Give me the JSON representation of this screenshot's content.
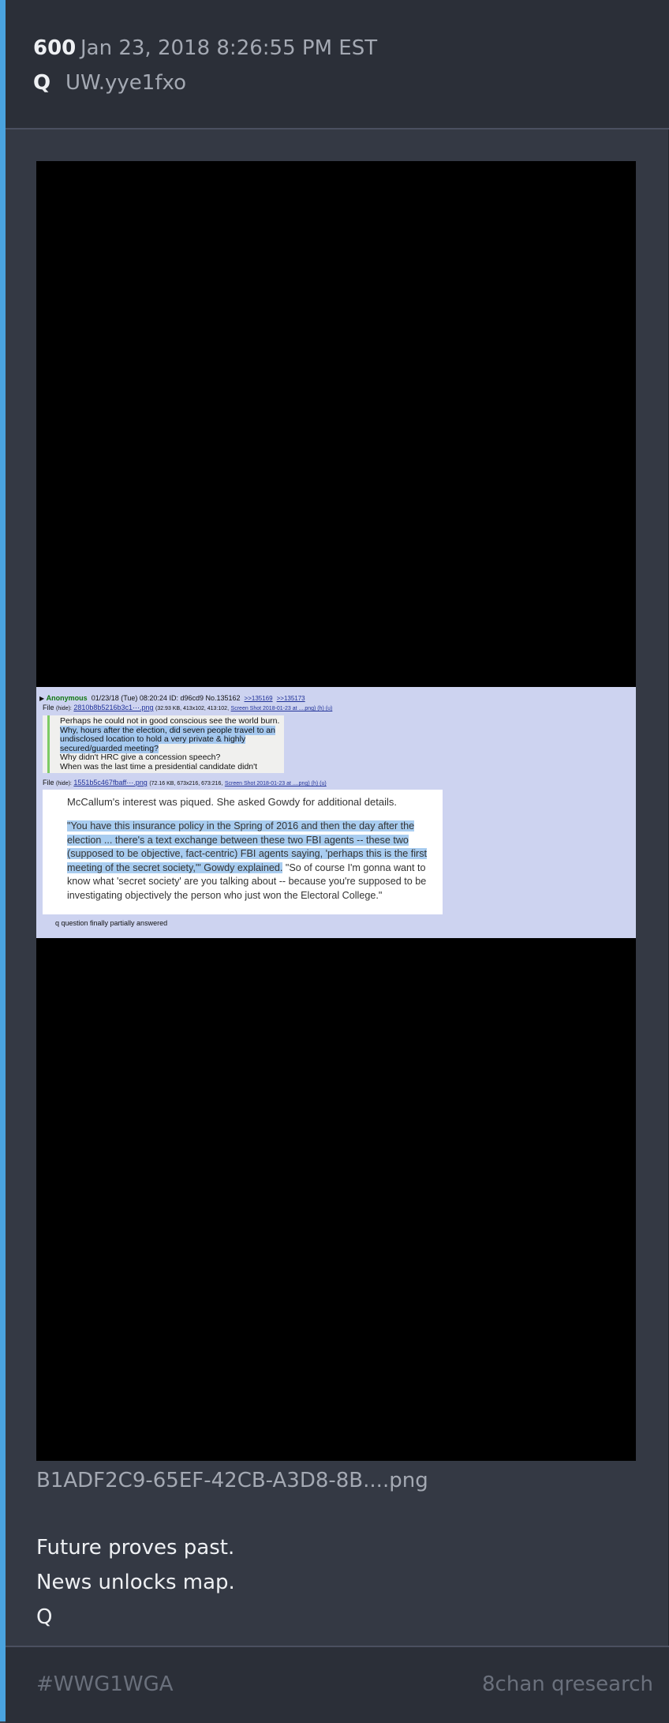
{
  "post": {
    "number": "600",
    "date": "Jan 23, 2018 8:26:55 PM EST",
    "author": "Q",
    "tripcode": "UW.yye1fxo"
  },
  "embedded_screenshot": {
    "poster_name": "Anonymous",
    "post_meta": "01/23/18 (Tue) 08:20:24 ID: d96cd9 No.135162",
    "backlinks": [
      ">>135169",
      ">>135173"
    ],
    "file1_prefix": "File",
    "file1_hide": "(hide):",
    "file1_name": "2810b8b5216b3c1⋯.png",
    "file1_info": "(32.93 KB, 413x102, 413:102,",
    "file1_orig": "Screen Shot 2018-01-23 at ....png) (h) (u)",
    "quote_lines": [
      "Perhaps he could not in good conscious see the world burn.",
      "Why, hours after the election, did seven people travel to an",
      "undisclosed location to hold a very private & highly",
      "secured/guarded meeting?",
      "Why didn't HRC give a concession speech?",
      "When was the last time a presidential candidate didn't"
    ],
    "file2_prefix": "File",
    "file2_hide": "(hide):",
    "file2_name": "1551b5c467fbaff⋯.png",
    "file2_info": "(72.16 KB, 673x216, 673:216,",
    "file2_orig": "Screen Shot 2018-01-23 at ....png) (h) (u)",
    "article_lead": "McCallum's interest was piqued. She asked Gowdy for additional details.",
    "article_quote_highlighted": "\"You have this insurance policy in the Spring of 2016 and then the day after the election ... there's a text exchange between these two FBI agents -- these two (supposed to be objective, fact-centric) FBI agents saying, 'perhaps this is the first meeting of the secret society,'\" Gowdy explained.",
    "article_quote_rest": " \"So of course I'm gonna want to know what 'secret society' are you talking about -- because you're supposed to be investigating objectively the person who just won the Electoral College.\"",
    "caption": "q question finally partially answered"
  },
  "attachment_filename": "B1ADF2C9-65EF-42CB-A3D8-8B....png",
  "message_lines": [
    "Future proves past.",
    "News unlocks map.",
    "Q"
  ],
  "footer": {
    "hashtag": "#WWG1WGA",
    "source": "8chan qresearch"
  },
  "colors": {
    "accent": "#4aa3df",
    "card_bg": "#343944",
    "header_bg": "#2b2f38",
    "text_primary": "#eef0f3",
    "text_secondary": "#a4a9b3",
    "text_muted": "#6a707c"
  }
}
